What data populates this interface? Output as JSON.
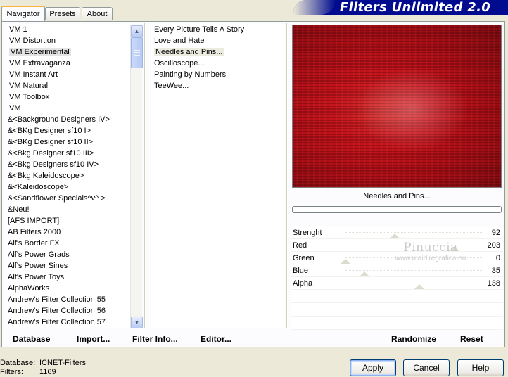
{
  "tabs": [
    {
      "label": "Navigator",
      "active": true
    },
    {
      "label": "Presets",
      "active": false
    },
    {
      "label": "About",
      "active": false
    }
  ],
  "header": {
    "title": "Filters Unlimited 2.0"
  },
  "categories": [
    {
      "label": "VM 1"
    },
    {
      "label": "VM Distortion"
    },
    {
      "label": "VM Experimental",
      "selected": true
    },
    {
      "label": "VM Extravaganza"
    },
    {
      "label": "VM Instant Art"
    },
    {
      "label": "VM Natural"
    },
    {
      "label": "VM Toolbox"
    },
    {
      "label": "VM"
    },
    {
      "label": "&<Background Designers IV>"
    },
    {
      "label": "&<BKg Designer sf10 I>"
    },
    {
      "label": "&<BKg Designer sf10 II>"
    },
    {
      "label": "&<Bkg Designer sf10 III>"
    },
    {
      "label": "&<Bkg Designers sf10 IV>"
    },
    {
      "label": "&<Bkg Kaleidoscope>"
    },
    {
      "label": "&<Kaleidoscope>"
    },
    {
      "label": "&<Sandflower Specials^v^ >"
    },
    {
      "label": "&Neu!"
    },
    {
      "label": "[AFS IMPORT]"
    },
    {
      "label": "AB Filters 2000"
    },
    {
      "label": "Alf's Border FX"
    },
    {
      "label": "Alf's Power Grads"
    },
    {
      "label": "Alf's Power Sines"
    },
    {
      "label": "Alf's Power Toys"
    },
    {
      "label": "AlphaWorks"
    },
    {
      "label": "Andrew's Filter Collection 55"
    },
    {
      "label": "Andrew's Filter Collection 56"
    },
    {
      "label": "Andrew's Filter Collection 57"
    }
  ],
  "filters": [
    {
      "label": "Every Picture Tells A Story"
    },
    {
      "label": "Love and Hate"
    },
    {
      "label": "Needles and Pins...",
      "selected": true
    },
    {
      "label": "Oscilloscope..."
    },
    {
      "label": "Painting by Numbers"
    },
    {
      "label": "TeeWee..."
    }
  ],
  "preview": {
    "label": "Needles and Pins...",
    "dominant_color": "#b8121b"
  },
  "sliders": [
    {
      "label": "Strenght",
      "value": "92",
      "level": 0.36
    },
    {
      "label": "Red",
      "value": "203",
      "level": 0.8
    },
    {
      "label": "Green",
      "value": "0",
      "level": 0.0
    },
    {
      "label": "Blue",
      "value": "35",
      "level": 0.14
    },
    {
      "label": "Alpha",
      "value": "138",
      "level": 0.54
    }
  ],
  "watermark": {
    "name": "Pinuccia",
    "url": "www.maidiregrafica.eu"
  },
  "bottom_links": {
    "database": "Database",
    "import": "Import...",
    "filter_info": "Filter Info...",
    "editor": "Editor...",
    "randomize": "Randomize",
    "reset": "Reset"
  },
  "footer": {
    "database_key": "Database:",
    "database_value": "ICNET-Filters",
    "filters_key": "Filters:",
    "filters_value": "1169"
  },
  "buttons": {
    "apply": "Apply",
    "cancel": "Cancel",
    "help": "Help"
  },
  "colors": {
    "accent_tab": "#f8b33b",
    "banner": "#000b8f"
  }
}
